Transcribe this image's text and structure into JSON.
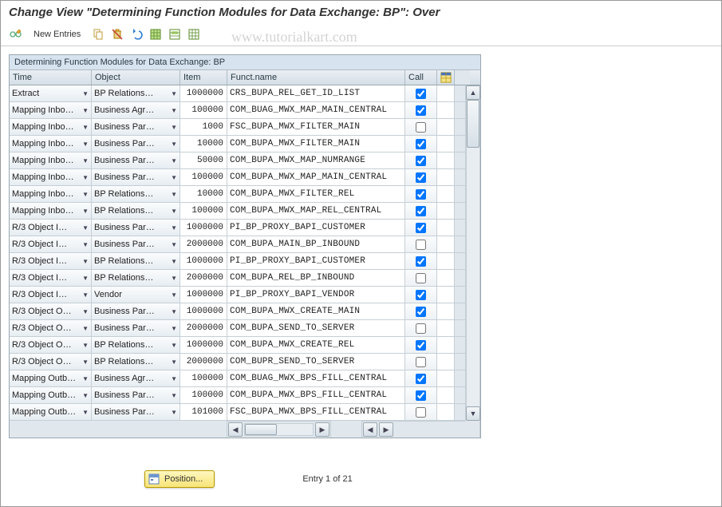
{
  "header": {
    "title": "Change View \"Determining Function Modules for Data Exchange: BP\": Over"
  },
  "watermark": "www.tutorialkart.com",
  "toolbar": {
    "new_entries": "New Entries"
  },
  "panel": {
    "title": "Determining Function Modules for Data Exchange: BP",
    "columns": {
      "time": "Time",
      "object": "Object",
      "item": "Item",
      "func": "Funct.name",
      "call": "Call"
    }
  },
  "rows": [
    {
      "time": "Extract",
      "object": "BP Relations…",
      "item": "1000000",
      "func": "CRS_BUPA_REL_GET_ID_LIST",
      "call": true
    },
    {
      "time": "Mapping Inbo…",
      "object": "Business Agr…",
      "item": "100000",
      "func": "COM_BUAG_MWX_MAP_MAIN_CENTRAL",
      "call": true
    },
    {
      "time": "Mapping Inbo…",
      "object": "Business Par…",
      "item": "1000",
      "func": "FSC_BUPA_MWX_FILTER_MAIN",
      "call": false
    },
    {
      "time": "Mapping Inbo…",
      "object": "Business Par…",
      "item": "10000",
      "func": "COM_BUPA_MWX_FILTER_MAIN",
      "call": true
    },
    {
      "time": "Mapping Inbo…",
      "object": "Business Par…",
      "item": "50000",
      "func": "COM_BUPA_MWX_MAP_NUMRANGE",
      "call": true
    },
    {
      "time": "Mapping Inbo…",
      "object": "Business Par…",
      "item": "100000",
      "func": "COM_BUPA_MWX_MAP_MAIN_CENTRAL",
      "call": true
    },
    {
      "time": "Mapping Inbo…",
      "object": "BP Relations…",
      "item": "10000",
      "func": "COM_BUPA_MWX_FILTER_REL",
      "call": true
    },
    {
      "time": "Mapping Inbo…",
      "object": "BP Relations…",
      "item": "100000",
      "func": "COM_BUPA_MWX_MAP_REL_CENTRAL",
      "call": true
    },
    {
      "time": "R/3 Object I…",
      "object": "Business Par…",
      "item": "1000000",
      "func": "PI_BP_PROXY_BAPI_CUSTOMER",
      "call": true
    },
    {
      "time": "R/3 Object I…",
      "object": "Business Par…",
      "item": "2000000",
      "func": "COM_BUPA_MAIN_BP_INBOUND",
      "call": false
    },
    {
      "time": "R/3 Object I…",
      "object": "BP Relations…",
      "item": "1000000",
      "func": "PI_BP_PROXY_BAPI_CUSTOMER",
      "call": true
    },
    {
      "time": "R/3 Object I…",
      "object": "BP Relations…",
      "item": "2000000",
      "func": "COM_BUPA_REL_BP_INBOUND",
      "call": false
    },
    {
      "time": "R/3 Object I…",
      "object": "Vendor",
      "item": "1000000",
      "func": "PI_BP_PROXY_BAPI_VENDOR",
      "call": true
    },
    {
      "time": "R/3 Object O…",
      "object": "Business Par…",
      "item": "1000000",
      "func": "COM_BUPA_MWX_CREATE_MAIN",
      "call": true
    },
    {
      "time": "R/3 Object O…",
      "object": "Business Par…",
      "item": "2000000",
      "func": "COM_BUPA_SEND_TO_SERVER",
      "call": false
    },
    {
      "time": "R/3 Object O…",
      "object": "BP Relations…",
      "item": "1000000",
      "func": "COM_BUPA_MWX_CREATE_REL",
      "call": true
    },
    {
      "time": "R/3 Object O…",
      "object": "BP Relations…",
      "item": "2000000",
      "func": "COM_BUPR_SEND_TO_SERVER",
      "call": false
    },
    {
      "time": "Mapping Outb…",
      "object": "Business Agr…",
      "item": "100000",
      "func": "COM_BUAG_MWX_BPS_FILL_CENTRAL",
      "call": true
    },
    {
      "time": "Mapping Outb…",
      "object": "Business Par…",
      "item": "100000",
      "func": "COM_BUPA_MWX_BPS_FILL_CENTRAL",
      "call": true
    },
    {
      "time": "Mapping Outb…",
      "object": "Business Par…",
      "item": "101000",
      "func": "FSC_BUPA_MWX_BPS_FILL_CENTRAL",
      "call": false
    }
  ],
  "footer": {
    "position": "Position...",
    "entry": "Entry 1 of 21"
  }
}
